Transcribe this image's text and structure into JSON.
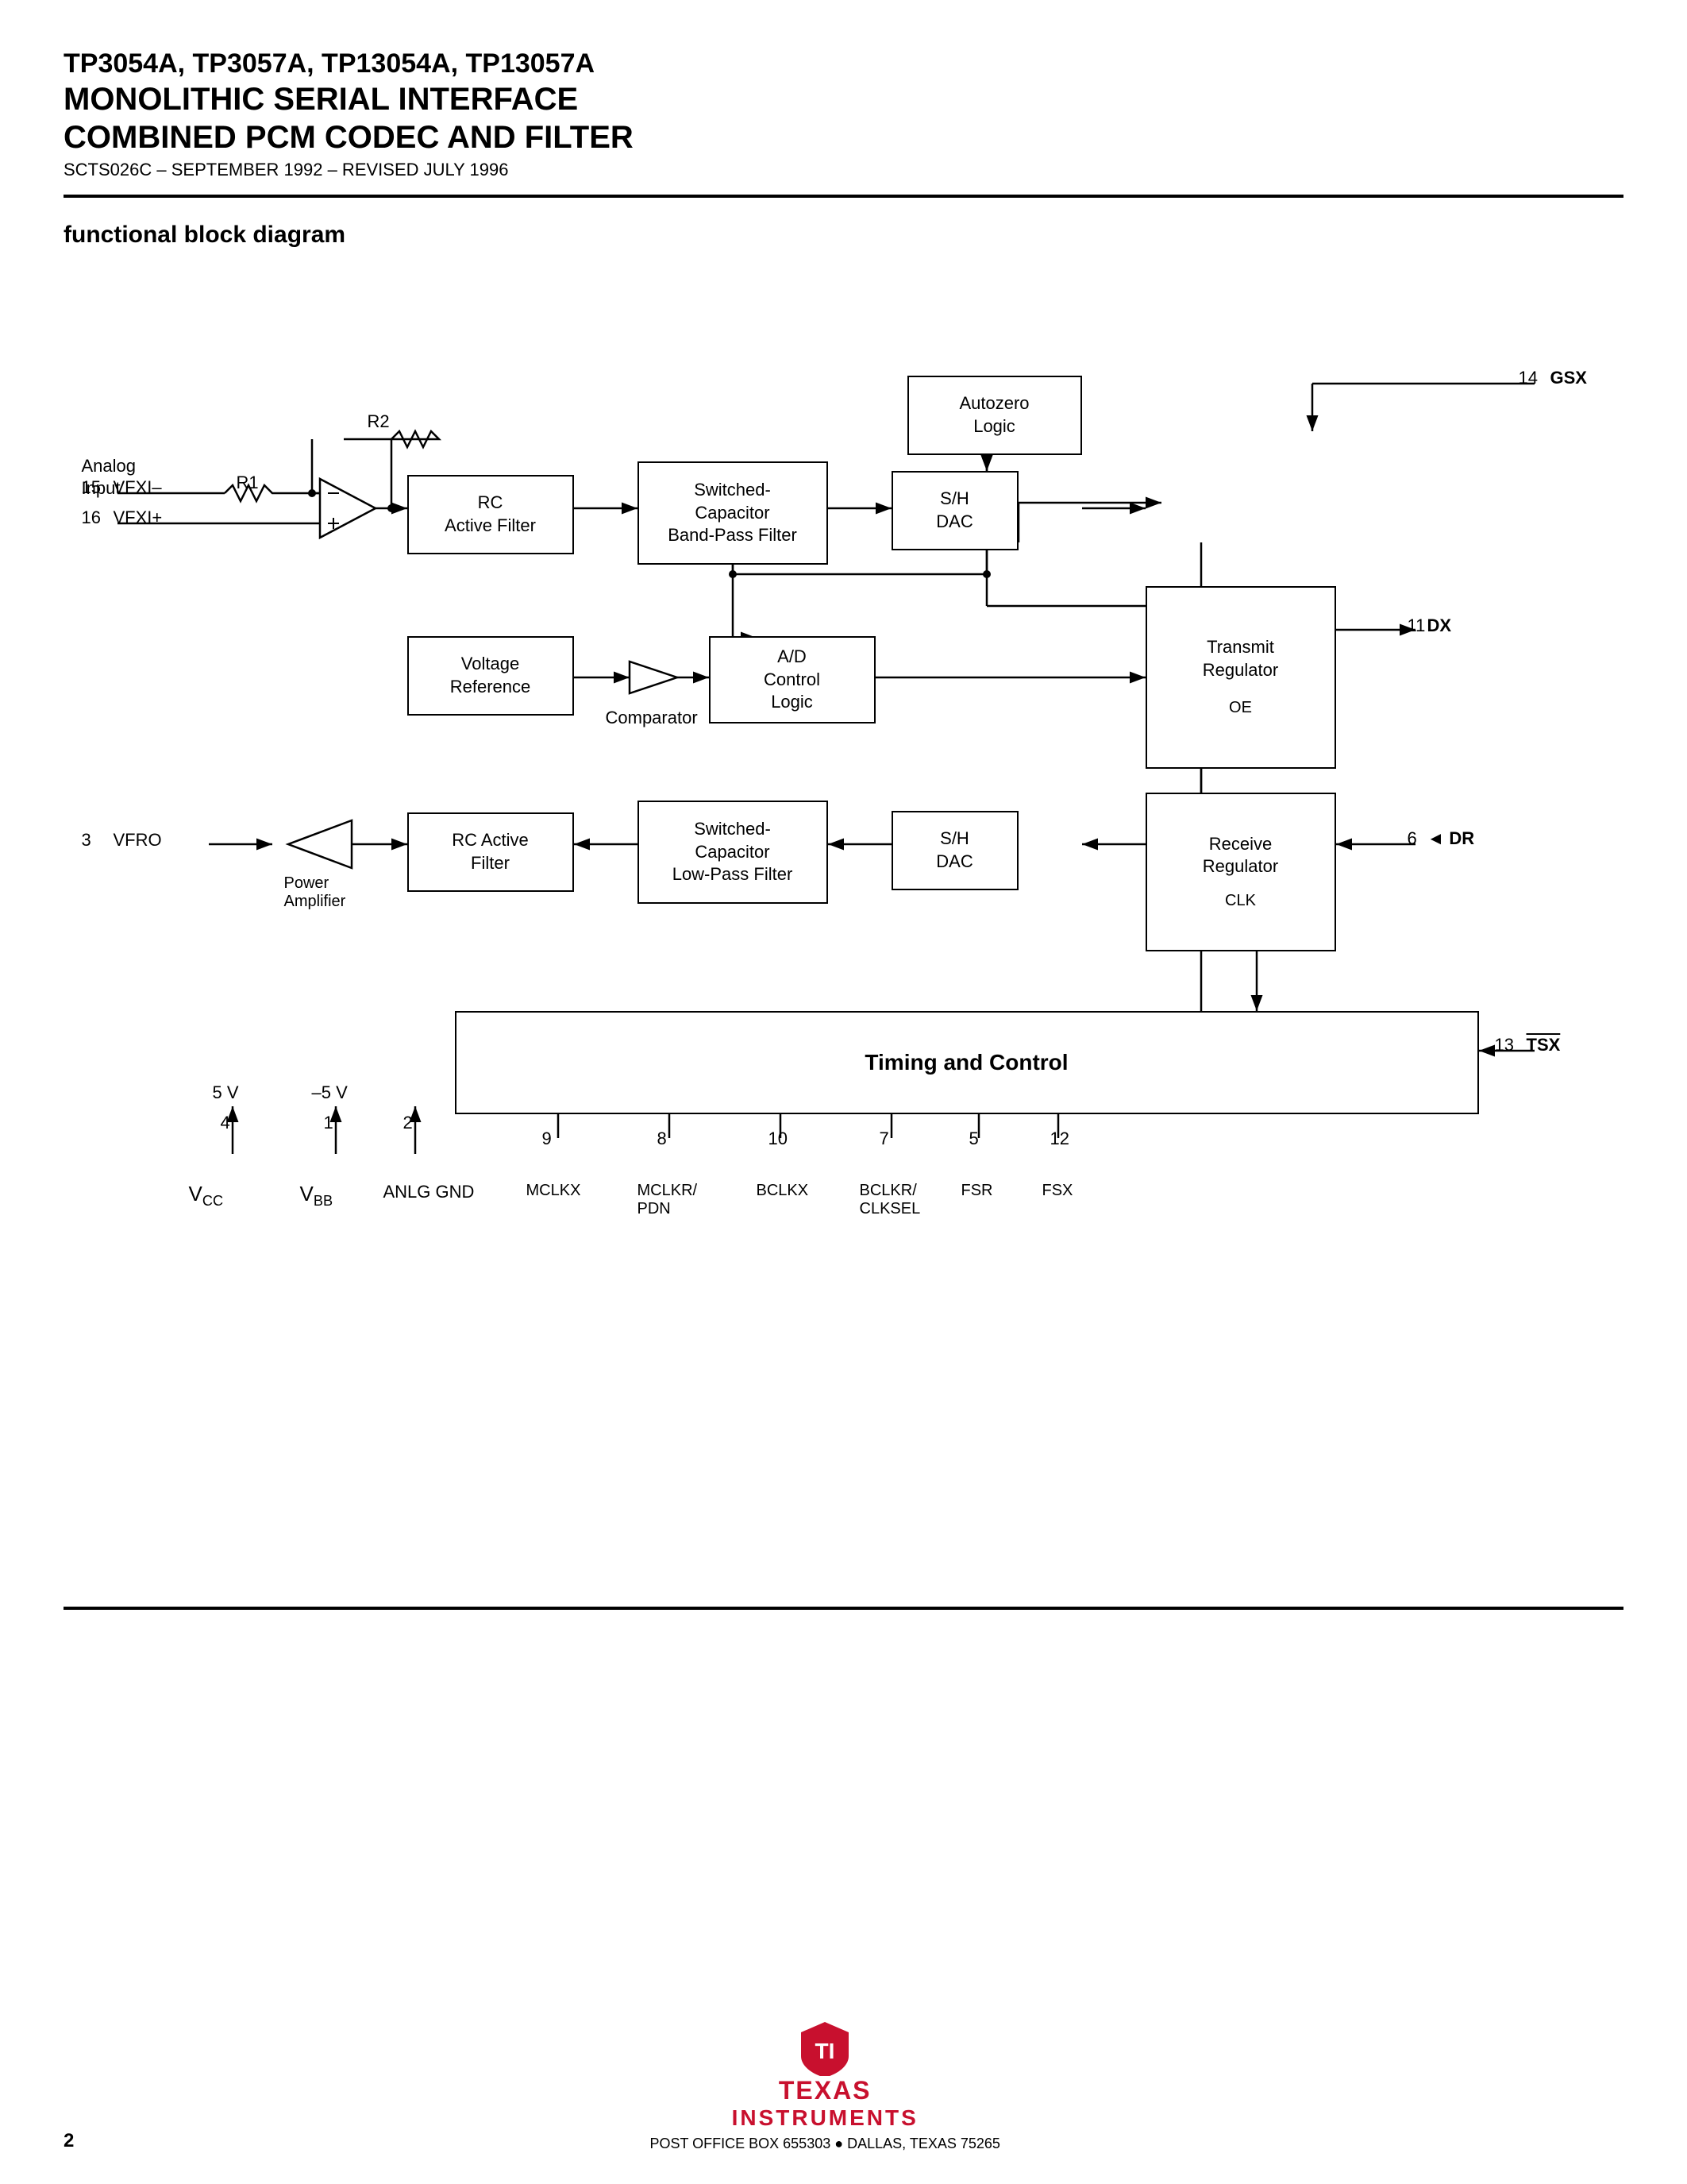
{
  "header": {
    "line1": "TP3054A, TP3057A, TP13054A, TP13057A",
    "line2": "MONOLITHIC SERIAL INTERFACE",
    "line3": "COMBINED PCM CODEC AND FILTER",
    "subtitle": "SCTS026C – SEPTEMBER 1992 – REVISED JULY 1996"
  },
  "section": {
    "title": "functional block diagram"
  },
  "blocks": {
    "rc_active_filter_top": "RC\nActive Filter",
    "switched_cap_bpf": "Switched-\nCapacitor\nBand-Pass Filter",
    "sh_dac_top": "S/H\nDAC",
    "autozero_logic": "Autozero\nLogic",
    "voltage_reference": "Voltage\nReference",
    "ad_control_logic": "A/D\nControl\nLogic",
    "transmit_regulator": "Transmit\nRegulator",
    "rc_active_filter_bot": "RC Active\nFilter",
    "switched_cap_lpf": "Switched-\nCapacitor\nLow-Pass Filter",
    "sh_dac_bot": "S/H\nDAC",
    "receive_regulator": "Receive\nRegulator",
    "timing_and_control": "Timing and Control"
  },
  "signals": {
    "analog_input": "Analog\nInput",
    "vfxi_minus": "VFXI–",
    "vfxi_plus": "VFXI+",
    "vfro": "VFRO",
    "gsx": "GSX",
    "dx": "DX",
    "dr": "DR",
    "tsx": "TSX",
    "comparator": "Comparator",
    "oe": "OE",
    "clk": "CLK",
    "power_amplifier": "Power\nAmplifier",
    "r1": "R1",
    "r2": "R2",
    "vcc": "VCC",
    "vbb": "VBB",
    "anlg_gnd": "ANLG GND",
    "v5": "5 V",
    "vm5": "–5 V",
    "mclkx": "MCLKX",
    "mclkr_pdn": "MCLKR/\nPDN",
    "bclkx": "BCLKX",
    "bclkr_clksel": "BCLKR/\nCLKSEL",
    "fsr": "FSR",
    "fsx": "FSX"
  },
  "pins": {
    "pin14": "14",
    "pin15": "15",
    "pin16": "16",
    "pin11": "11",
    "pin6": "6",
    "pin3": "3",
    "pin13": "13",
    "pin4": "4",
    "pin1": "1",
    "pin2": "2",
    "pin9": "9",
    "pin8": "8",
    "pin10": "10",
    "pin7": "7",
    "pin5": "5",
    "pin12": "12"
  },
  "footer": {
    "page_number": "2",
    "address": "POST OFFICE BOX 655303 ● DALLAS, TEXAS 75265",
    "company_line1": "TEXAS",
    "company_line2": "INSTRUMENTS"
  }
}
